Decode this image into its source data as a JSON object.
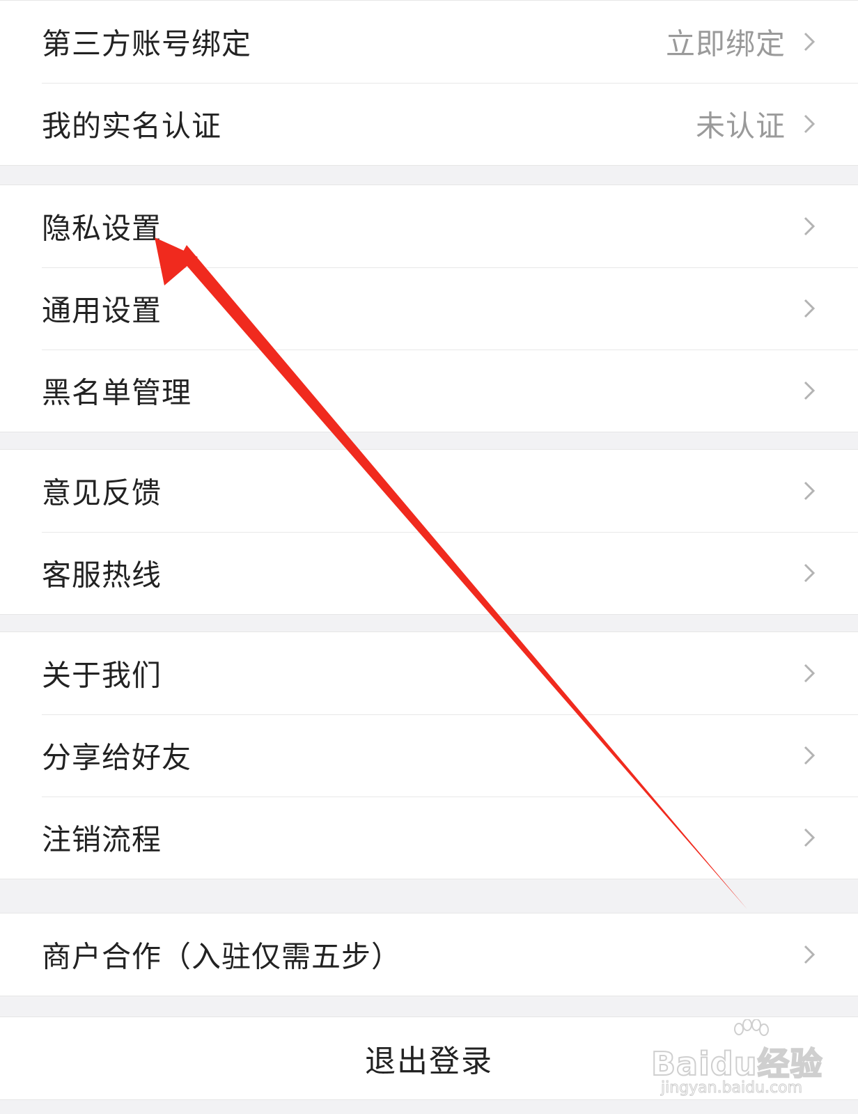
{
  "account_section": {
    "items": [
      {
        "label": "第三方账号绑定",
        "value": "立即绑定"
      },
      {
        "label": "我的实名认证",
        "value": "未认证"
      }
    ]
  },
  "settings_section": {
    "items": [
      {
        "label": "隐私设置"
      },
      {
        "label": "通用设置"
      },
      {
        "label": "黑名单管理"
      }
    ]
  },
  "support_section": {
    "items": [
      {
        "label": "意见反馈"
      },
      {
        "label": "客服热线"
      }
    ]
  },
  "about_section": {
    "items": [
      {
        "label": "关于我们"
      },
      {
        "label": "分享给好友"
      },
      {
        "label": "注销流程"
      }
    ]
  },
  "merchant_section": {
    "items": [
      {
        "label": "商户合作（入驻仅需五步）"
      }
    ]
  },
  "logout": {
    "label": "退出登录"
  },
  "watermark": {
    "brand": "Baidu经验",
    "url": "jingyan.baidu.com"
  },
  "annotation": {
    "arrow_color": "#f02a1e",
    "target": "隐私设置"
  },
  "icons": {
    "row_chevron": "chevron-right-icon"
  }
}
